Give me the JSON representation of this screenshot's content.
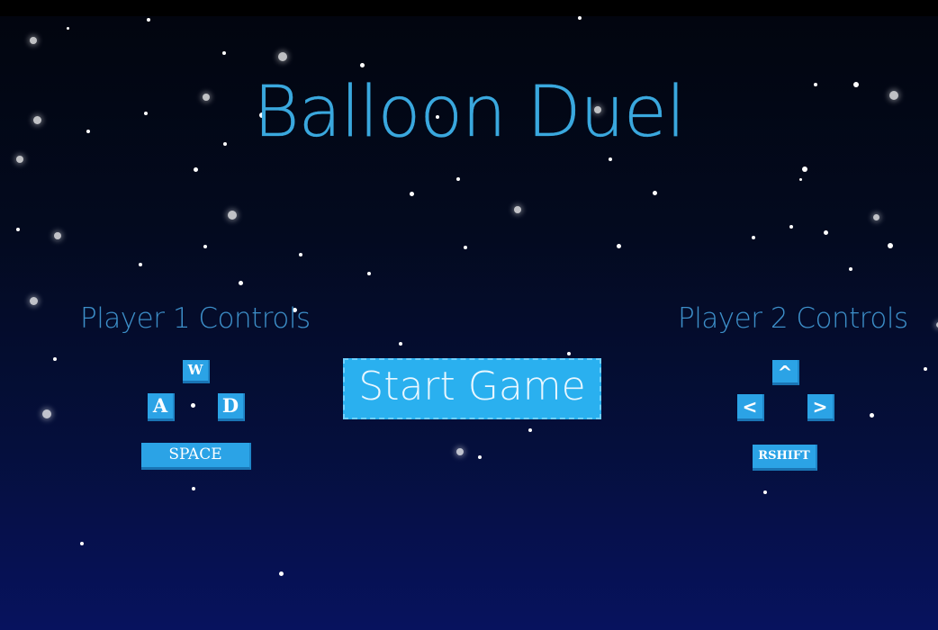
{
  "game": {
    "title": "Balloon Duel",
    "start_button": "Start Game"
  },
  "player1": {
    "heading": "Player 1 Controls",
    "keys": {
      "up": "W",
      "left": "A",
      "right": "D",
      "fire": "SPACE"
    }
  },
  "player2": {
    "heading": "Player 2 Controls",
    "keys": {
      "up": "^",
      "left": "<",
      "right": ">",
      "fire": "RSHIFT"
    }
  },
  "colors": {
    "title": "#3aa8de",
    "key_fill": "#2ba3e6",
    "button_fill": "#2ab0ef",
    "sky_top": "#02050f",
    "sky_bottom": "#07125e"
  }
}
